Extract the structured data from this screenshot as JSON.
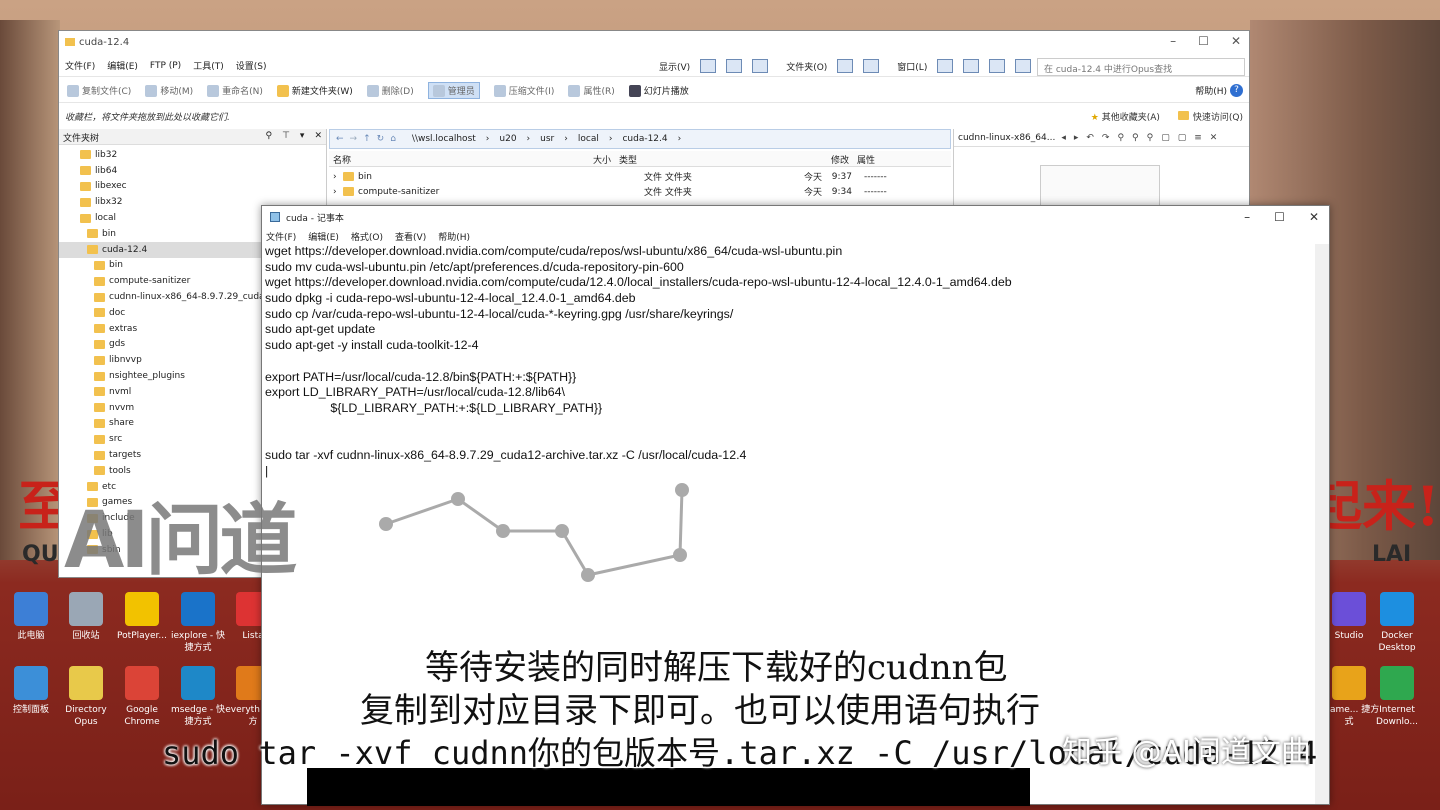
{
  "explorer": {
    "title": "cuda-12.4",
    "menu": [
      "文件(F)",
      "编辑(E)",
      "FTP (P)",
      "工具(T)",
      "设置(S)"
    ],
    "menu_right": [
      "显示(V)",
      "文件夹(O)",
      "窗口(L)"
    ],
    "search_placeholder": "在 cuda-12.4 中进行Opus查找",
    "toolbar": [
      "复制文件(C)",
      "移动(M)",
      "重命名(N)",
      "新建文件夹(W)",
      "删除(D)",
      "管理员",
      "压缩文件(I)",
      "属性(R)",
      "幻灯片播放"
    ],
    "help": "帮助(H)",
    "fav_hint": "收藏栏，将文件夹拖放到此处以收藏它们.",
    "fav_other": "其他收藏夹(A)",
    "quick_access": "快速访问(Q)",
    "tree_header": "文件夹树",
    "tree": [
      {
        "label": "lib32",
        "indent": 1
      },
      {
        "label": "lib64",
        "indent": 1
      },
      {
        "label": "libexec",
        "indent": 1
      },
      {
        "label": "libx32",
        "indent": 1
      },
      {
        "label": "local",
        "indent": 1
      },
      {
        "label": "bin",
        "indent": 2
      },
      {
        "label": "cuda-12.4",
        "indent": 2,
        "selected": true
      },
      {
        "label": "bin",
        "indent": 3
      },
      {
        "label": "compute-sanitizer",
        "indent": 3
      },
      {
        "label": "cudnn-linux-x86_64-8.9.7.29_cuda1",
        "indent": 3
      },
      {
        "label": "doc",
        "indent": 3
      },
      {
        "label": "extras",
        "indent": 3
      },
      {
        "label": "gds",
        "indent": 3
      },
      {
        "label": "libnvvp",
        "indent": 3
      },
      {
        "label": "nsightee_plugins",
        "indent": 3
      },
      {
        "label": "nvml",
        "indent": 3
      },
      {
        "label": "nvvm",
        "indent": 3
      },
      {
        "label": "share",
        "indent": 3
      },
      {
        "label": "src",
        "indent": 3
      },
      {
        "label": "targets",
        "indent": 3
      },
      {
        "label": "tools",
        "indent": 3
      },
      {
        "label": "etc",
        "indent": 2
      },
      {
        "label": "games",
        "indent": 2
      },
      {
        "label": "include",
        "indent": 2
      },
      {
        "label": "lib",
        "indent": 2
      },
      {
        "label": "sbin",
        "indent": 2
      }
    ],
    "path": [
      "\\\\wsl.localhost",
      "u20",
      "usr",
      "local",
      "cuda-12.4"
    ],
    "columns": [
      "名称",
      "大小",
      "类型",
      "修改",
      "属性"
    ],
    "rows": [
      {
        "name": "bin",
        "type": "文件 文件夹",
        "date": "今天",
        "time": "9:37",
        "attr": "-------"
      },
      {
        "name": "compute-sanitizer",
        "type": "文件 文件夹",
        "date": "今天",
        "time": "9:34",
        "attr": "-------"
      }
    ],
    "preview_title": "cudnn-linux-x86_64..."
  },
  "notepad": {
    "title": "cuda - 记事本",
    "menu": [
      "文件(F)",
      "编辑(E)",
      "格式(O)",
      "查看(V)",
      "帮助(H)"
    ],
    "lines": [
      "wget https://developer.download.nvidia.com/compute/cuda/repos/wsl-ubuntu/x86_64/cuda-wsl-ubuntu.pin",
      "sudo mv cuda-wsl-ubuntu.pin /etc/apt/preferences.d/cuda-repository-pin-600",
      "wget https://developer.download.nvidia.com/compute/cuda/12.4.0/local_installers/cuda-repo-wsl-ubuntu-12-4-local_12.4.0-1_amd64.deb",
      "sudo dpkg -i cuda-repo-wsl-ubuntu-12-4-local_12.4.0-1_amd64.deb",
      "sudo cp /var/cuda-repo-wsl-ubuntu-12-4-local/cuda-*-keyring.gpg /usr/share/keyrings/",
      "sudo apt-get update",
      "sudo apt-get -y install cuda-toolkit-12-4",
      "",
      "export PATH=/usr/local/cuda-12.8/bin${PATH:+:${PATH}}",
      "export LD_LIBRARY_PATH=/usr/local/cuda-12.8/lib64\\",
      "                   ${LD_LIBRARY_PATH:+:${LD_LIBRARY_PATH}}",
      "",
      "",
      "sudo tar -xvf cudnn-linux-x86_64-8.9.7.29_cuda12-archive.tar.xz -C /usr/local/cuda-12.4",
      "|"
    ]
  },
  "desktop": [
    {
      "label": "此电脑",
      "color": "#3d7fd6"
    },
    {
      "label": "回收站",
      "color": "#9aa7b5"
    },
    {
      "label": "PotPlayer...",
      "color": "#f2c200"
    },
    {
      "label": "iexplore - 快捷方式",
      "color": "#1a73c9"
    },
    {
      "label": "Lista",
      "color": "#d33"
    },
    {
      "label": "控制面板",
      "color": "#3c8fd8"
    },
    {
      "label": "Directory Opus",
      "color": "#e8c94a"
    },
    {
      "label": "Google Chrome",
      "color": "#db4437"
    },
    {
      "label": "msedge - 快捷方式",
      "color": "#1e88c8"
    },
    {
      "label": "everyth 快捷方",
      "color": "#e07a1a"
    }
  ],
  "desktop_right": [
    {
      "label": "Studio",
      "color": "#6b4fd8"
    },
    {
      "label": "Docker Desktop",
      "color": "#1d8fe0"
    },
    {
      "label": "ename... 捷方式",
      "color": "#e8a31a"
    },
    {
      "label": "Internet Downlo...",
      "color": "#2fa84f"
    }
  ],
  "poster_left": "至",
  "poster_left_sub": "QU",
  "poster_right": "起来!",
  "poster_right_sub": "LAI",
  "watermark": "AI问道",
  "subtitles": {
    "line1": "等待安装的同时解压下载好的cudnn包",
    "line2": "复制到对应目录下即可。也可以使用语句执行",
    "line3": "sudo tar -xvf cudnn你的包版本号.tar.xz -C /usr/local/cuda-12.4"
  },
  "zhihu": "知乎 @AI问道文曲"
}
